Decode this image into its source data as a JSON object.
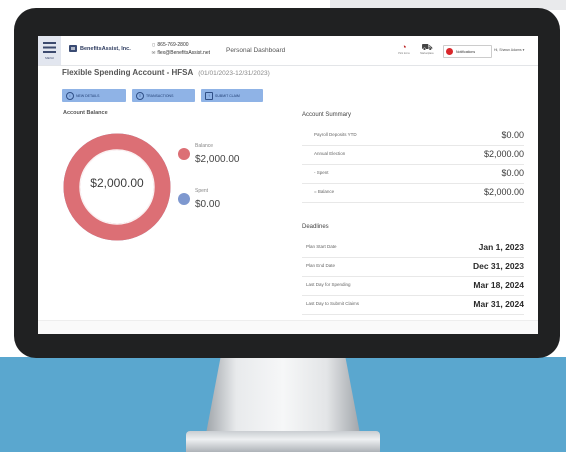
{
  "header": {
    "menu_label": "MENU",
    "logo_text": "BenefitsAssist, Inc.",
    "phone": "865-769-2800",
    "email": "flex@BenefitsAssist.net",
    "page_label": "Personal Dashboard",
    "utilities": [
      {
        "label": "Pick Icons",
        "icon": "pick-icon"
      },
      {
        "label": "Marketplace",
        "icon": "cart-icon"
      }
    ],
    "notifications_label": "Notifications",
    "user_greeting": "Hi, Shawn Adams"
  },
  "account": {
    "title": "Flexible Spending Account - HFSA",
    "period": "(01/01/2023-12/31/2023)"
  },
  "buttons": [
    {
      "label": "NEW DETAILS",
      "icon": "info-icon"
    },
    {
      "label": "TRANSACTIONS",
      "icon": "list-icon"
    },
    {
      "label": "SUBMIT CLAIM",
      "icon": "upload-icon"
    }
  ],
  "balance_panel": {
    "title": "Account Balance",
    "center_value": "$2,000.00",
    "legend": [
      {
        "label": "Balance",
        "value": "$2,000.00",
        "color": "#dc6f75"
      },
      {
        "label": "Spent",
        "value": "$0.00",
        "color": "#7e98cf"
      }
    ],
    "balance_fraction": 1.0
  },
  "summary": {
    "title": "Account Summary",
    "rows": [
      {
        "label": "Payroll Deposits YTD",
        "value": "$0.00"
      },
      {
        "label": "Annual Election",
        "value": "$2,000.00"
      },
      {
        "label": "- Spent",
        "value": "$0.00"
      },
      {
        "label": "= Balance",
        "value": "$2,000.00"
      }
    ]
  },
  "deadlines": {
    "title": "Deadlines",
    "rows": [
      {
        "label": "Plan Start Date",
        "value": "Jan 1, 2023"
      },
      {
        "label": "Plan End Date",
        "value": "Dec 31, 2023"
      },
      {
        "label": "Last Day for Spending",
        "value": "Mar 18, 2024"
      },
      {
        "label": "Last Day to Submit Claims",
        "value": "Mar 31, 2024"
      }
    ]
  },
  "colors": {
    "accent": "#8fb3e6",
    "balance_ring": "#dc6f75",
    "spent": "#7e98cf",
    "backdrop": "#5aa7cf"
  }
}
